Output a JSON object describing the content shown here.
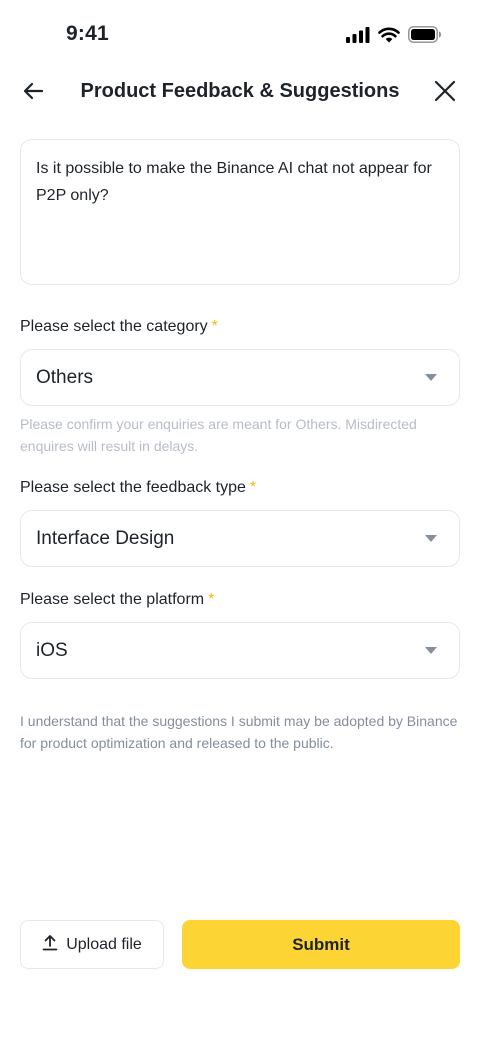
{
  "status_bar": {
    "time": "9:41",
    "icons": [
      "cellular-signal-icon",
      "wifi-icon",
      "battery-icon"
    ]
  },
  "header": {
    "title": "Product Feedback & Suggestions",
    "back_icon": "arrow-left-icon",
    "close_icon": "close-icon"
  },
  "feedback": {
    "text": "Is it possible to make the Binance AI chat not appear for P2P only?"
  },
  "category": {
    "label": "Please select the category",
    "required": "*",
    "value": "Others",
    "helper": "Please confirm your enquiries are meant for Others. Misdirected enquires will result in delays."
  },
  "feedback_type": {
    "label": "Please select the feedback type",
    "required": "*",
    "value": "Interface Design"
  },
  "platform": {
    "label": "Please select the platform",
    "required": "*",
    "value": "iOS"
  },
  "disclaimer": "I understand that the suggestions I submit may be adopted by Binance for product optimization and released to the public.",
  "actions": {
    "upload_label": "Upload file",
    "submit_label": "Submit"
  },
  "colors": {
    "accent": "#FCD535",
    "required_star": "#F0B90B",
    "border": "#E6E8EA",
    "muted_text": "#B7BDC6"
  }
}
